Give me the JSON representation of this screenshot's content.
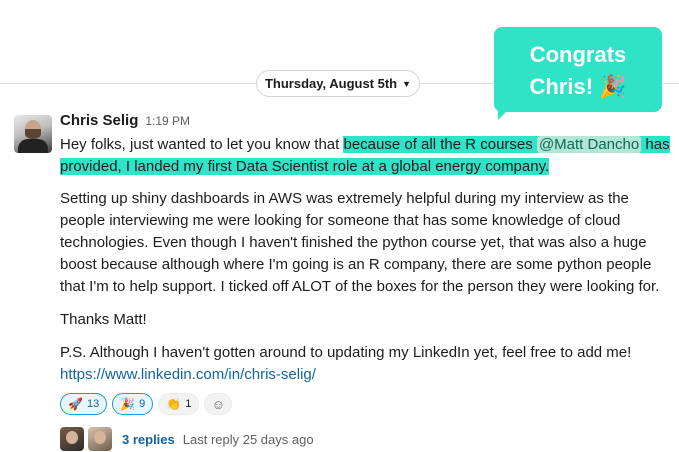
{
  "date_divider": {
    "label": "Thursday, August 5th"
  },
  "message": {
    "author": "Chris Selig",
    "time": "1:19 PM",
    "p1_before": "Hey folks, just wanted to let you know that ",
    "p1_hl_start": "because of all the R courses ",
    "mention": "@Matt Dancho",
    "p1_hl_end": " has provided, I landed my first Data Scientist role at a global energy company.",
    "p2": "Setting up shiny dashboards in AWS was extremely helpful during my interview as the people interviewing me were looking for someone that has some knowledge of cloud technologies. Even though I haven't finished the python course yet, that was also a huge boost because although where I'm going is an R company, there are some python people that I'm to help support. I ticked off ALOT of the boxes for the person they were looking for.",
    "p3": "Thanks Matt!",
    "p4": "P.S. Although I haven't gotten around to updating my LinkedIn yet, feel free to add me!",
    "link": "https://www.linkedin.com/in/chris-selig/"
  },
  "reactions": [
    {
      "emoji": "🚀",
      "count": "13"
    },
    {
      "emoji": "🎉",
      "count": "9"
    },
    {
      "emoji": "👏",
      "count": "1"
    }
  ],
  "add_reaction_icon": "add-emoji-icon",
  "thread": {
    "count": "3 replies",
    "last": "Last reply 25 days ago"
  },
  "callout": {
    "line1": "Congrats",
    "line2": "Chris! 🎉"
  },
  "colors": {
    "accent": "#2fe3c7",
    "link": "#1264a3"
  }
}
